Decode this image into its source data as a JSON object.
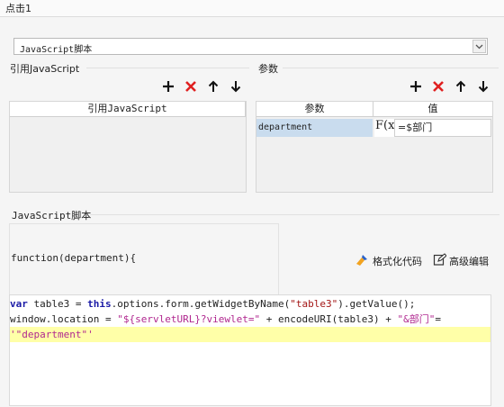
{
  "window": {
    "title": "点击1"
  },
  "script_type_select": {
    "value": "JavaScript脚本"
  },
  "references_section": {
    "title": "引用JavaScript",
    "column_header": "引用JavaScript"
  },
  "params_section": {
    "title": "参数",
    "columns": [
      "参数",
      "值"
    ],
    "rows": [
      {
        "name": "department",
        "formula_icon": "F(x)",
        "value": "=$部门"
      }
    ]
  },
  "script_section": {
    "title": "JavaScript脚本",
    "signature": "function(department){",
    "format_label": "格式化代码",
    "advanced_label": "高级编辑"
  },
  "code": {
    "line1": [
      "var",
      " table3 = ",
      "this",
      ".options.form.getWidgetByName(",
      "\"table3\"",
      ").getValue();"
    ],
    "line2": [
      "window.location = ",
      "\"${servletURL}?viewlet=\"",
      " + encodeURI(table3) + ",
      "\"&部门\"",
      "="
    ],
    "line3": [
      "'\"department\"'"
    ]
  },
  "colors": {
    "add": "#111111",
    "delete": "#e02020",
    "selected_row": "#c9dcee",
    "current_line": "#ffffa8"
  },
  "icons": [
    "plus-icon",
    "delete-x-icon",
    "arrow-up-icon",
    "arrow-down-icon",
    "formula-icon",
    "brush-icon",
    "edit-icon",
    "chevron-down-icon"
  ]
}
